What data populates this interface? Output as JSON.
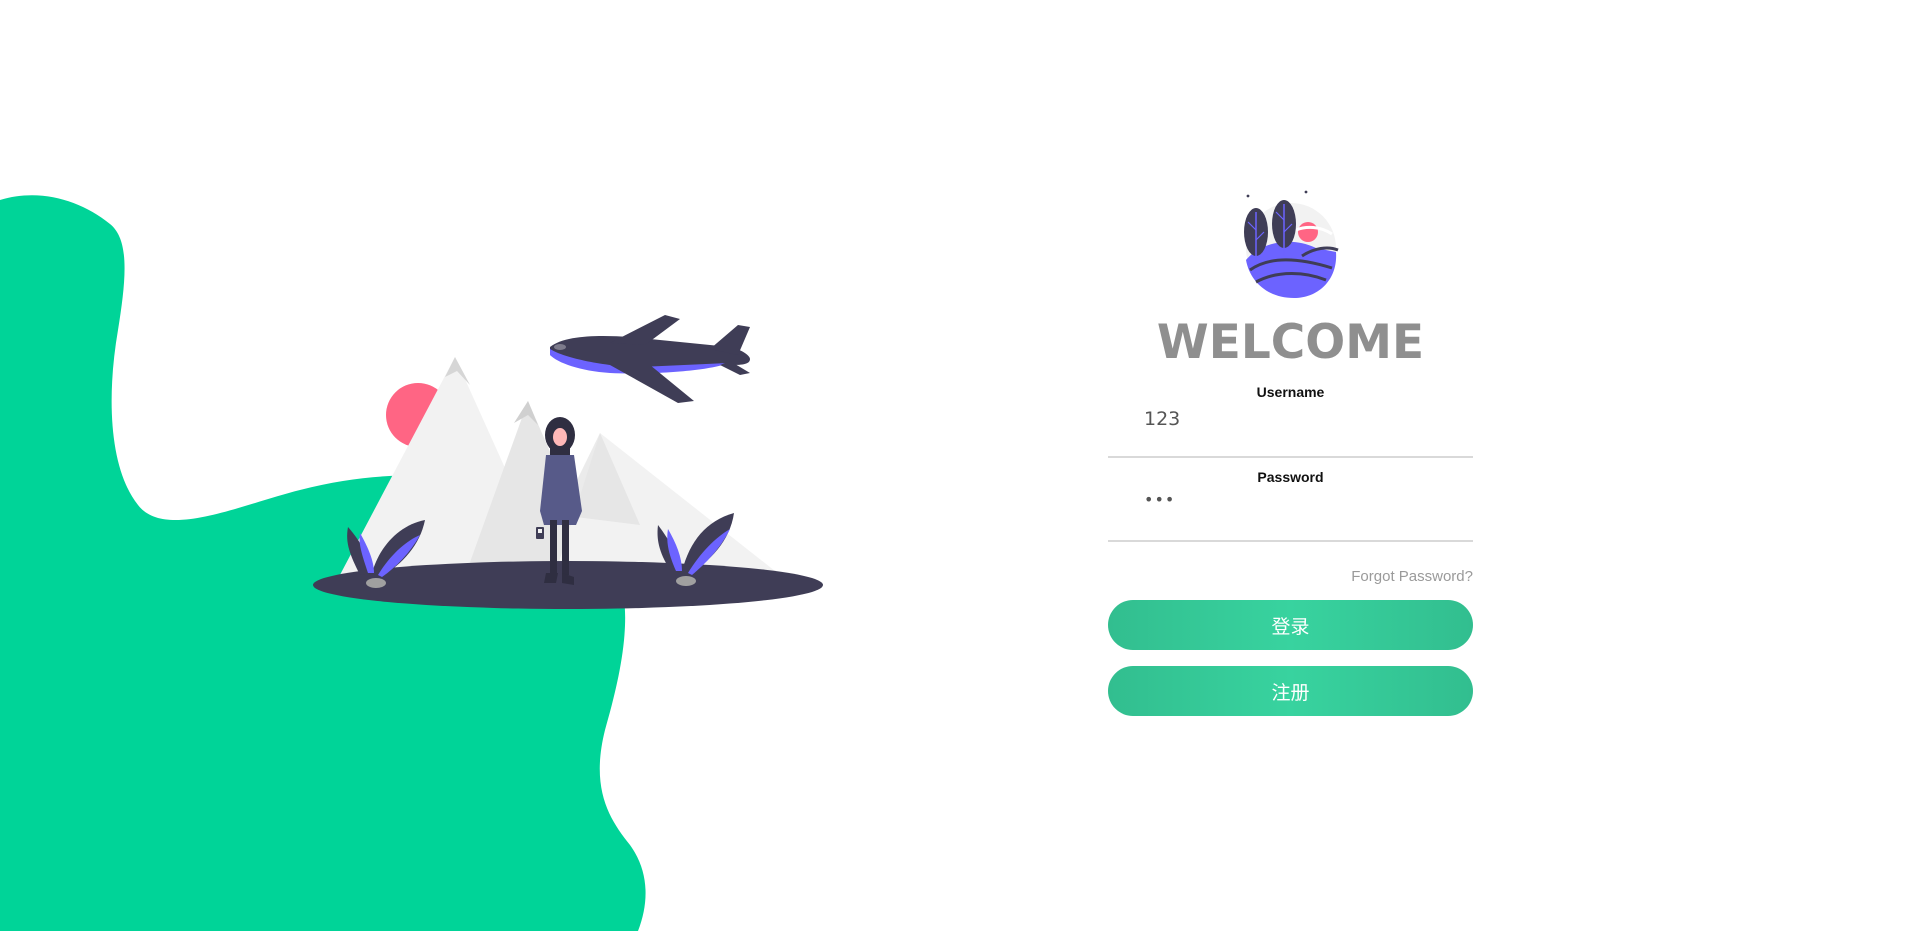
{
  "login": {
    "title": "WELCOME",
    "username": {
      "label": "Username",
      "value": "123"
    },
    "password": {
      "label": "Password",
      "value": "•••"
    },
    "forgot_label": "Forgot Password?",
    "login_button_label": "登录",
    "register_button_label": "注册"
  },
  "illustration": {
    "name": "traveler-mountains-airplane",
    "colors": {
      "wave": "#00d498",
      "accent": "#6c63ff",
      "dark": "#3f3d56",
      "sun": "#ff6584",
      "mountain": "#f2f2f2"
    }
  },
  "avatar": {
    "name": "plants-sun-hill-avatar"
  },
  "theme": {
    "button_gradient_start": "#32be8f",
    "button_gradient_end": "#38d39f",
    "title_color": "#8f8f8f",
    "link_color": "#9a9a9a"
  }
}
